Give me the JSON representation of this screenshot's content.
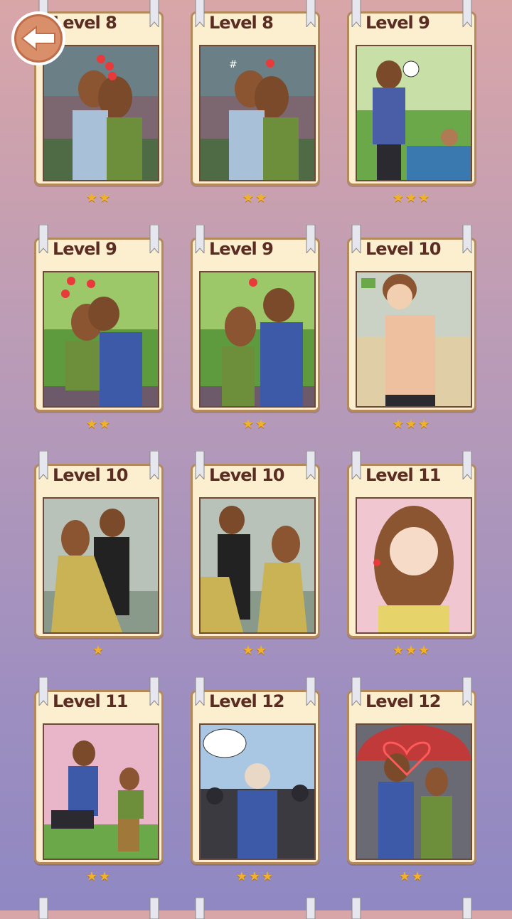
{
  "back_button": {
    "icon": "back-arrow-icon"
  },
  "cards": [
    {
      "level": "Level 8",
      "stars": "★★",
      "scene": "kiss-stadium"
    },
    {
      "level": "Level 8",
      "stars": "★★",
      "scene": "kiss-stadium-angry"
    },
    {
      "level": "Level 9",
      "stars": "★★★",
      "scene": "boy-garden-teddy"
    },
    {
      "level": "Level 9",
      "stars": "★★",
      "scene": "kiss-garden"
    },
    {
      "level": "Level 9",
      "stars": "★★",
      "scene": "hug-garden"
    },
    {
      "level": "Level 10",
      "stars": "★★★",
      "scene": "shirtless-boy"
    },
    {
      "level": "Level 10",
      "stars": "★",
      "scene": "dance-gold-dress"
    },
    {
      "level": "Level 10",
      "stars": "★★",
      "scene": "dance-gold-dress-2"
    },
    {
      "level": "Level 11",
      "stars": "★★★",
      "scene": "girl-wink"
    },
    {
      "level": "Level 11",
      "stars": "★★",
      "scene": "jump-blossoms"
    },
    {
      "level": "Level 12",
      "stars": "★★★",
      "scene": "bald-boy-crowd"
    },
    {
      "level": "Level 12",
      "stars": "★★",
      "scene": "couple-umbrella"
    }
  ],
  "colors": {
    "frame": "#fbefd0",
    "border": "#b58a5a",
    "star": "#f0b12e",
    "title": "#5a2c22"
  }
}
